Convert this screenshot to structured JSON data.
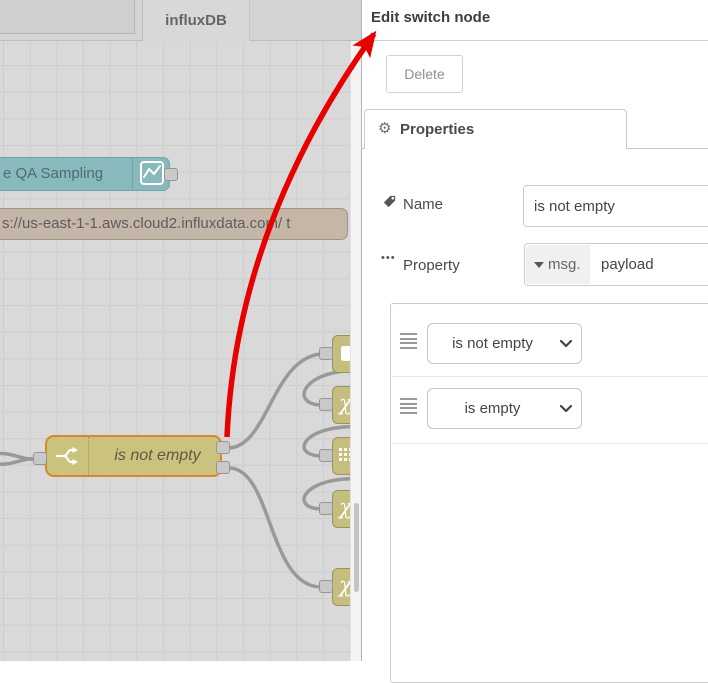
{
  "workspace": {
    "tabs": [
      {
        "label": ""
      },
      {
        "label": "influxDB"
      }
    ],
    "nodes": {
      "chart": {
        "label": "e QA Sampling"
      },
      "influx": {
        "label": "s://us-east-1-1.aws.cloud2.influxdata.com/ t"
      },
      "switch": {
        "label": "is not empty"
      }
    }
  },
  "panel": {
    "title": "Edit switch node",
    "delete_label": "Delete",
    "tab_label": "Properties",
    "fields": {
      "name": {
        "label": "Name",
        "value": "is not empty"
      },
      "property": {
        "label": "Property",
        "prefix": "msg.",
        "value": "payload"
      }
    },
    "rules": [
      {
        "operator": "is not empty"
      },
      {
        "operator": "is empty"
      }
    ]
  },
  "icons": {
    "gear": "⚙",
    "swap_glyph": "χ",
    "ellipsis": "•••"
  },
  "colors": {
    "node_switch_fill": "#cbc37d",
    "node_switch_selected_border": "#d5892b",
    "node_chart_fill": "#88babd",
    "node_influx_fill": "#c5b7a8",
    "wire": "#999999",
    "annotation_arrow": "#e60000",
    "canvas_bg": "#d9d9d9"
  }
}
